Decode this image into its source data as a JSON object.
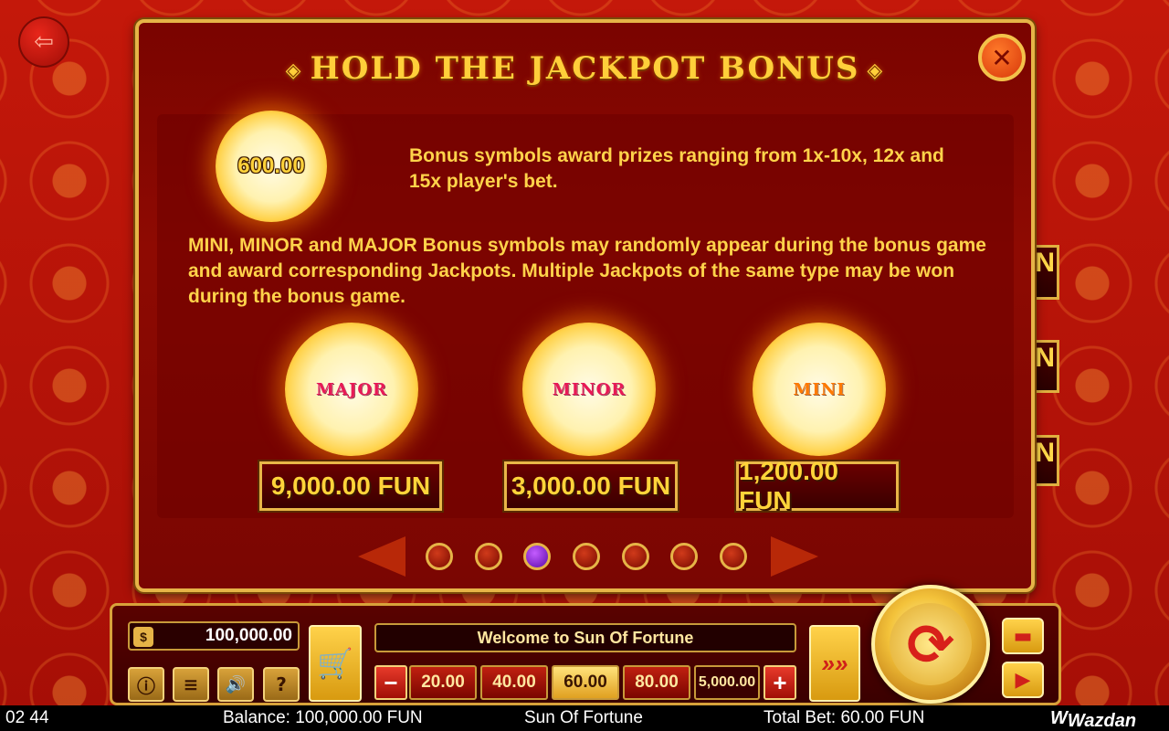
{
  "game": {
    "title": "HOLD THE JACKPOT BONUS",
    "sample_symbol_value": "600.00",
    "description_1": "Bonus symbols award prizes ranging from 1x-10x, 12x and 15x player's bet.",
    "description_2": "MINI, MINOR and MAJOR Bonus symbols may randomly appear during the bonus game and award corresponding Jackpots. Multiple Jackpots of the same type may be won during the bonus game.",
    "jackpots": [
      {
        "label": "MAJOR",
        "value": "9,000.00 FUN"
      },
      {
        "label": "MINOR",
        "value": "3,000.00 FUN"
      },
      {
        "label": "MINI",
        "value": "1,200.00 FUN"
      }
    ],
    "pages_total": 7,
    "page_active": 3
  },
  "controls": {
    "balance_box": "100,000.00",
    "message": "Welcome to Sun Of Fortune",
    "bets": [
      "20.00",
      "40.00",
      "60.00",
      "80.00",
      "5,000.00"
    ],
    "selected_bet": "60.00",
    "minus": "−",
    "plus": "+",
    "info": "ⓘ",
    "menu": "≡",
    "sound": "🔊",
    "help": "?",
    "auto": "»»"
  },
  "status": {
    "clock": "02 44",
    "balance": "Balance: 100,000.00 FUN",
    "game_name": "Sun Of Fortune",
    "total_bet": "Total Bet: 60.00 FUN",
    "brand": "Wazdan"
  },
  "icons": {
    "exit": "exit-icon",
    "close": "close-icon",
    "cart": "cart-icon",
    "spin": "spin-icon",
    "bag": "money-bag-icon"
  },
  "colors": {
    "accent_gold": "#e6b447",
    "panel_red": "#7a0400",
    "text_yellow": "#ffd34a"
  }
}
